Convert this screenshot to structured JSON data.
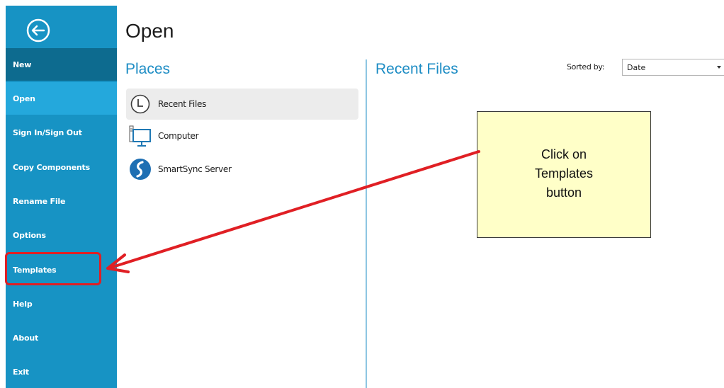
{
  "sidebar": {
    "back_icon": "back-arrow-icon",
    "items": [
      {
        "label": "New"
      },
      {
        "label": "Open"
      },
      {
        "label": "Sign In/Sign Out"
      },
      {
        "label": "Copy Components"
      },
      {
        "label": "Rename File"
      },
      {
        "label": "Options"
      },
      {
        "label": "Templates"
      },
      {
        "label": "Help"
      },
      {
        "label": "About"
      },
      {
        "label": "Exit"
      }
    ],
    "colors": {
      "background": "#1793c4",
      "selected_new": "#0d6b8f",
      "active_open": "#24a8dc"
    }
  },
  "main": {
    "title": "Open",
    "places_heading": "Places",
    "places": [
      {
        "label": "Recent Files",
        "icon": "clock-icon"
      },
      {
        "label": "Computer",
        "icon": "computer-icon"
      },
      {
        "label": "SmartSync Server",
        "icon": "smartsync-icon"
      }
    ],
    "recent_heading": "Recent Files",
    "sort": {
      "label": "Sorted by:",
      "value": "Date"
    }
  },
  "annotation": {
    "callout_text": "Click on Templates button",
    "callout_lines": [
      "Click on",
      "Templates",
      "button"
    ],
    "highlight_color": "#e01f24",
    "callout_bg": "#ffffc8"
  }
}
